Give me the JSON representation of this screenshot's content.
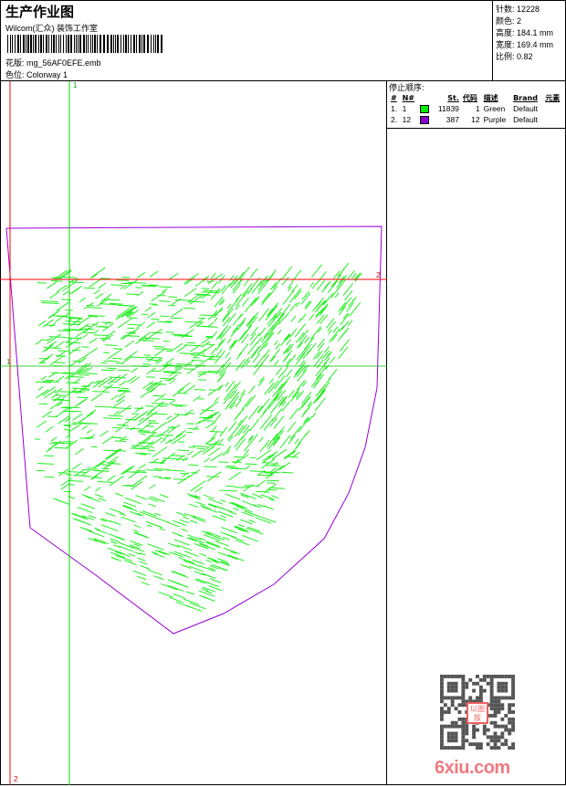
{
  "header": {
    "title": "生产作业图",
    "company": "Wilcom(汇众) 装饰工作室",
    "file_label": "花版:",
    "file_value": "mg_56AF0EFE.emb",
    "colorway_label": "色位:",
    "colorway_value": "Colorway 1"
  },
  "stats": {
    "stitches": "针数: 12228",
    "colors": "颜色: 2",
    "height": "高度: 184.1 mm",
    "width": "宽度: 169.4 mm",
    "scale": "比例: 0.82"
  },
  "stop_sequence": {
    "title": "停止顺序:",
    "columns": [
      "#",
      "N#",
      "St.",
      "代码",
      "描述",
      "Brand",
      "元素"
    ],
    "rows": [
      {
        "idx": "1.",
        "n": "1",
        "color": "#00ee00",
        "st": "11839",
        "code": "1",
        "desc": "Green",
        "brand": "Default"
      },
      {
        "idx": "2.",
        "n": "12",
        "color": "#8800cc",
        "st": "387",
        "code": "12",
        "desc": "Purple",
        "brand": "Default"
      }
    ]
  },
  "guides": {
    "v_green": "1",
    "v_red": "2",
    "h_red": "2",
    "h_green": "1"
  },
  "watermark": {
    "stamp": "以图版",
    "site": "6xiu.com"
  }
}
